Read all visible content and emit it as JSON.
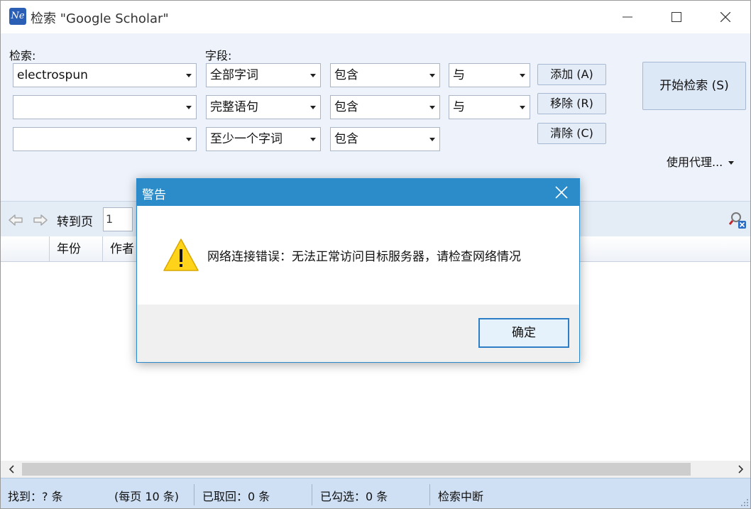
{
  "window": {
    "title": "检索 \"Google Scholar\"",
    "app_icon_text": "Ne",
    "accent": "#2b8cc9"
  },
  "search": {
    "search_label": "检索:",
    "field_label": "字段:",
    "rows": [
      {
        "term": "electrospun",
        "field": "全部字词",
        "op": "包含",
        "logic": "与"
      },
      {
        "term": "",
        "field": "完整语句",
        "op": "包含",
        "logic": "与"
      },
      {
        "term": "",
        "field": "至少一个字词",
        "op": "包含"
      }
    ],
    "add_button": "添加 (A)",
    "remove_button": "移除 (R)",
    "clear_button": "清除 (C)",
    "start_button": "开始检索 (S)",
    "proxy_label": "使用代理..."
  },
  "toolbar": {
    "goto_label": "转到页",
    "page_value": "1"
  },
  "table": {
    "columns": [
      "年份",
      "作者"
    ]
  },
  "status": {
    "found": "找到：? 条",
    "per_page": "(每页 10 条)",
    "retrieved": "已取回：0 条",
    "checked": "已勾选：0 条",
    "state": "检索中断"
  },
  "dialog": {
    "title": "警告",
    "message": "网络连接错误：无法正常访问目标服务器，请检查网络情况",
    "ok_button": "确定",
    "icon": "warning-icon"
  }
}
